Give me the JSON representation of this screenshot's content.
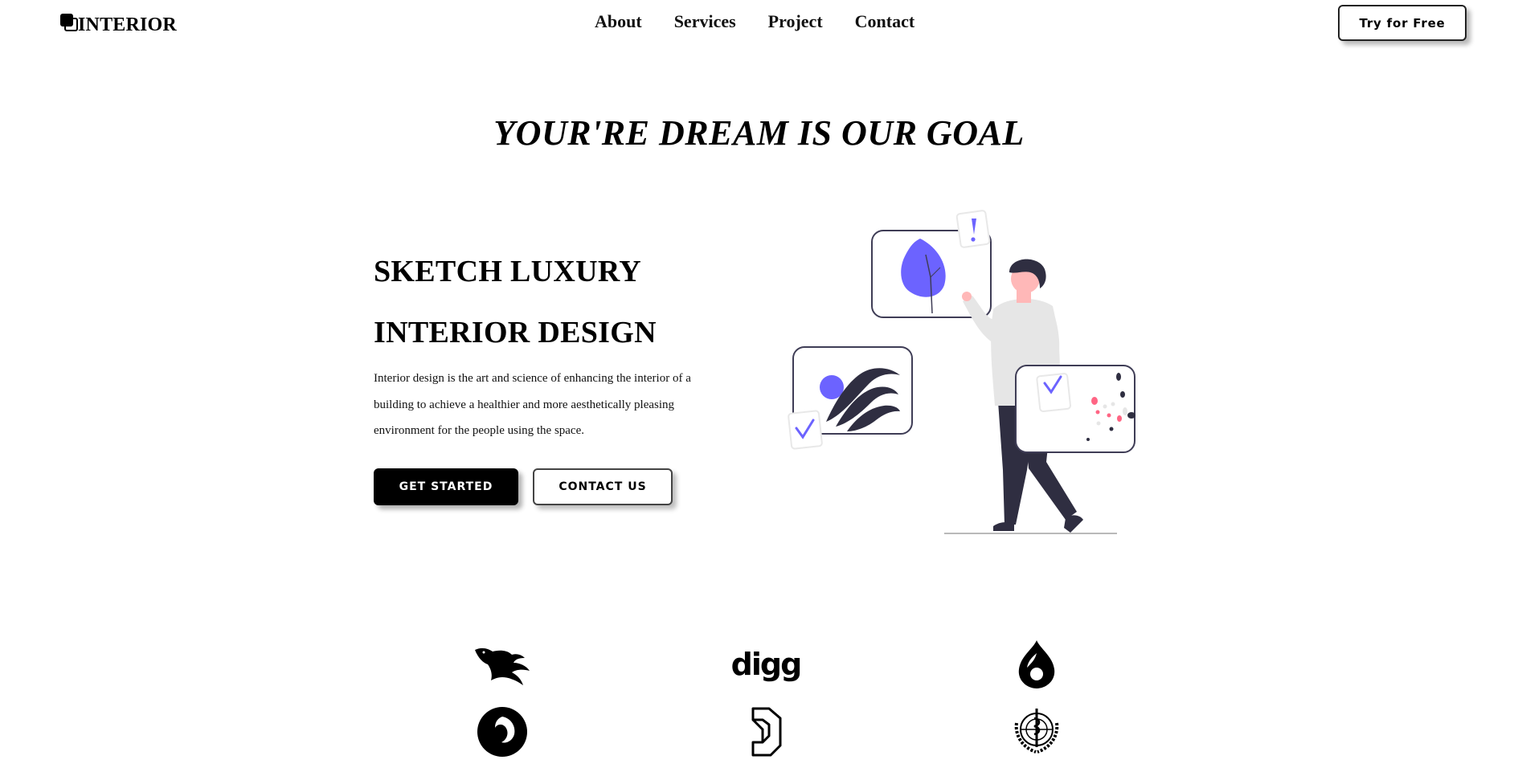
{
  "header": {
    "logo_text": "INTERIOR",
    "nav": [
      {
        "label": "About"
      },
      {
        "label": "Services"
      },
      {
        "label": "Project"
      },
      {
        "label": "Contact"
      }
    ],
    "cta_label": "Try for Free"
  },
  "hero": {
    "title": "YOUR'RE DREAM IS OUR GOAL",
    "headline_line1": "SKETCH LUXURY",
    "headline_line2": "INTERIOR DESIGN",
    "description": "Interior design is the art and science of enhancing the interior of a building to achieve a healthier and more aesthetically pleasing environment for the people using the space.",
    "primary_button": "GET STARTED",
    "secondary_button": "CONTACT US",
    "illustration_icon": "person-with-design-cards-illustration"
  },
  "partners": [
    {
      "icon": "phoenix-bird-icon"
    },
    {
      "icon": "digg-logo-icon"
    },
    {
      "icon": "drupal-drop-icon"
    },
    {
      "icon": "firefox-browser-icon"
    },
    {
      "icon": "dyalog-d-icon"
    },
    {
      "icon": "who-emblem-icon"
    }
  ],
  "partner_wordmark": "digg",
  "colors": {
    "accent": "#6c63ff",
    "dark": "#2f2e41",
    "skin": "#ffb8b8",
    "pink": "#ff6584",
    "shirt": "#e6e6e6"
  }
}
